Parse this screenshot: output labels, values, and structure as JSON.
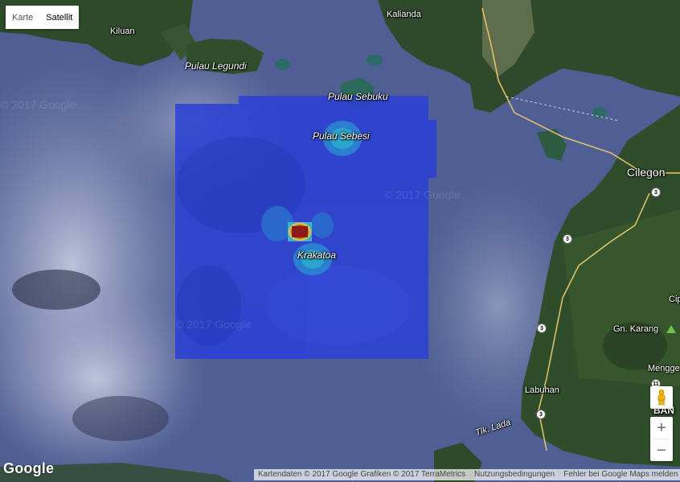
{
  "map_type_control": {
    "options": [
      "Karte",
      "Satellit"
    ],
    "selected": "Satellit"
  },
  "labels": {
    "kiluan": "Kiluan",
    "kalianda": "Kalianda",
    "pulau_legundi": "Pulau Legundi",
    "pulau_sebuku": "Pulau Sebuku",
    "pulau_sebesi": "Pulau Sebesi",
    "krakatoa": "Krakatoa",
    "cilegon": "Cilegon",
    "gn_karang": "Gn. Karang",
    "labuhan": "Labuhan",
    "tlk_lada": "Tlk. Lada",
    "menggen": "Mengge",
    "cip": "Cip",
    "ban": "BAN"
  },
  "watermark": "© 2017 Google",
  "route_shields": [
    "3",
    "3",
    "3",
    "3",
    "11"
  ],
  "controls": {
    "zoom_in": "+",
    "zoom_out": "−"
  },
  "logo": "Google",
  "footer": {
    "data": "Kartendaten © 2017 Google Grafiken © 2017 TerraMetrics",
    "terms": "Nutzungsbedingungen",
    "report": "Fehler bei Google Maps melden"
  },
  "colors": {
    "sea": "#4a5a8e",
    "overlay": "#2a3fd6",
    "land": "#2f4a2b",
    "hotspot": "#8b1a1a"
  }
}
